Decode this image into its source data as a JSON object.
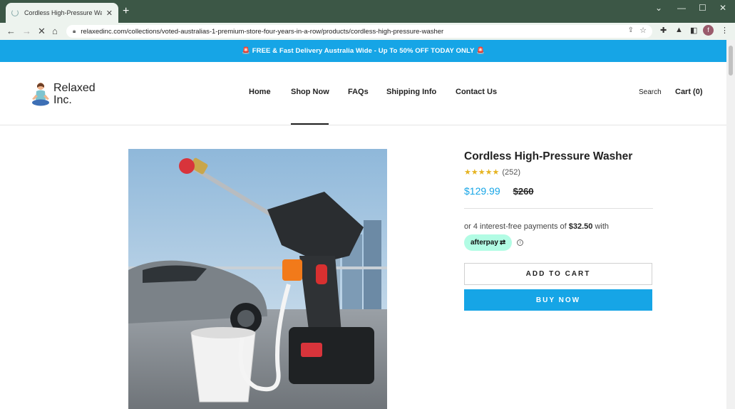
{
  "browser": {
    "tab_title": "Cordless High-Pressure Washer",
    "url": "relaxedinc.com/collections/voted-australias-1-premium-store-four-years-in-a-row/products/cordless-high-pressure-washer",
    "profile_initial": "f"
  },
  "announcement": "🚨 FREE & Fast Delivery Australia Wide - Up To 50% OFF TODAY ONLY 🚨",
  "header": {
    "logo_line1": "Relaxed",
    "logo_line2": "Inc.",
    "nav": [
      "Home",
      "Shop Now",
      "FAQs",
      "Shipping Info",
      "Contact Us"
    ],
    "active_nav": "Shop Now",
    "search": "Search",
    "cart": "Cart (0)"
  },
  "product": {
    "title": "Cordless High-Pressure Washer",
    "rating": 5,
    "review_count": "(252)",
    "price": "$129.99",
    "compare_price": "$260",
    "installments_prefix": "or 4 interest-free payments of",
    "installment_amount": "$32.50",
    "installments_suffix": "with",
    "afterpay_label": "afterpay",
    "add_to_cart": "ADD TO CART",
    "buy_now": "BUY NOW"
  },
  "colors": {
    "brand_blue": "#16a5e6",
    "afterpay_mint": "#b2fce4",
    "chrome_frame": "#3c5746"
  }
}
